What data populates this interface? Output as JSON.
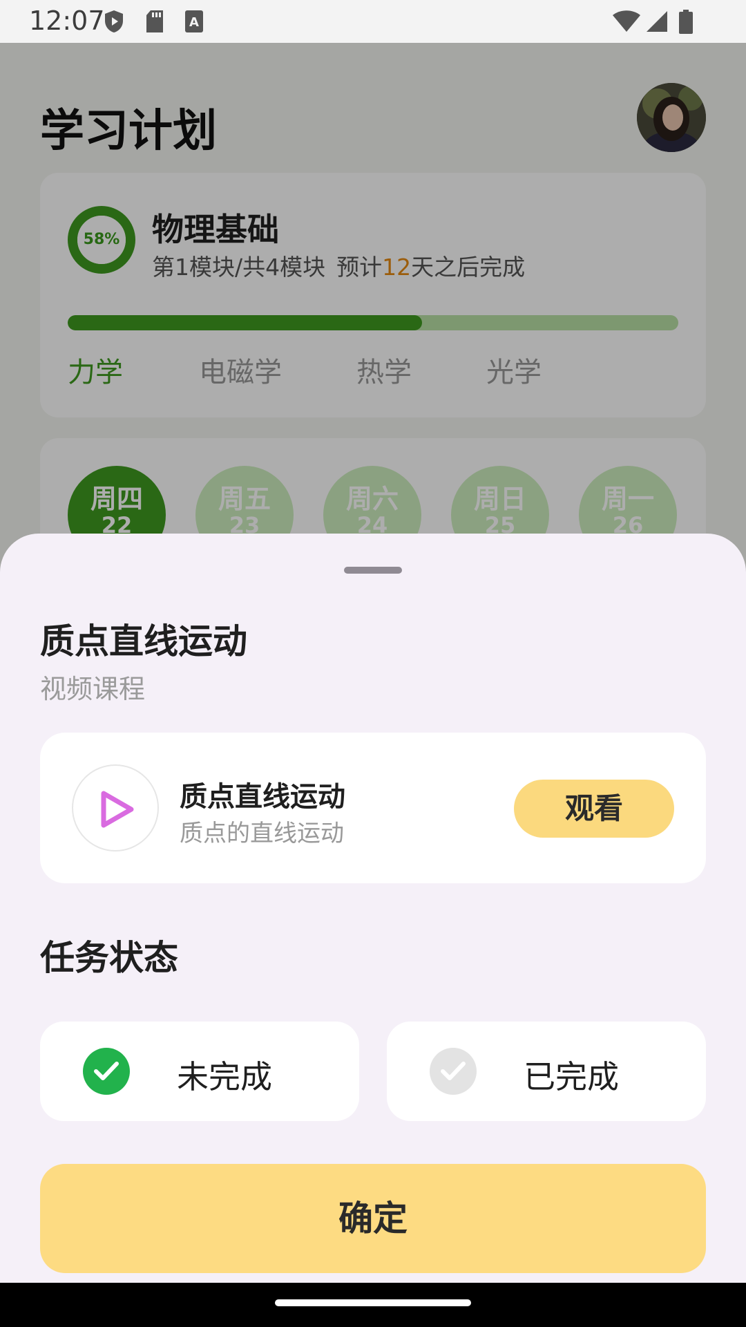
{
  "status_bar": {
    "time": "12:07",
    "icons": [
      "shield-icon",
      "sd-card-icon",
      "font-a-icon",
      "wifi-icon",
      "cellular-signal-icon",
      "battery-icon"
    ]
  },
  "page": {
    "title": "学习计划",
    "avatar_icon": "user-avatar"
  },
  "course": {
    "progress_percent": 58,
    "progress_label": "58%",
    "name": "物理基础",
    "module_info": "第1模块/共4模块",
    "estimate_prefix": "预计",
    "estimate_days": "12",
    "estimate_suffix": "天之后完成",
    "modules": [
      {
        "label": "力学",
        "active": true
      },
      {
        "label": "电磁学",
        "active": false
      },
      {
        "label": "热学",
        "active": false
      },
      {
        "label": "光学",
        "active": false
      }
    ]
  },
  "week": {
    "days": [
      {
        "name": "周四",
        "num": "22",
        "active": true
      },
      {
        "name": "周五",
        "num": "23",
        "active": false
      },
      {
        "name": "周六",
        "num": "24",
        "active": false
      },
      {
        "name": "周日",
        "num": "25",
        "active": false
      },
      {
        "name": "周一",
        "num": "26",
        "active": false
      }
    ]
  },
  "sheet": {
    "title": "质点直线运动",
    "subtitle": "视频课程",
    "video": {
      "icon": "play-icon",
      "title": "质点直线运动",
      "description": "质点的直线运动",
      "watch_label": "观看"
    },
    "status_heading": "任务状态",
    "options": [
      {
        "label": "未完成",
        "selected": true
      },
      {
        "label": "已完成",
        "selected": false
      }
    ],
    "confirm_label": "确定"
  },
  "colors": {
    "accent_green": "#3f9a1f",
    "light_green": "#cdeebe",
    "orange": "#e58a12",
    "yellow_button": "#fddb82",
    "check_green": "#22b24c"
  }
}
